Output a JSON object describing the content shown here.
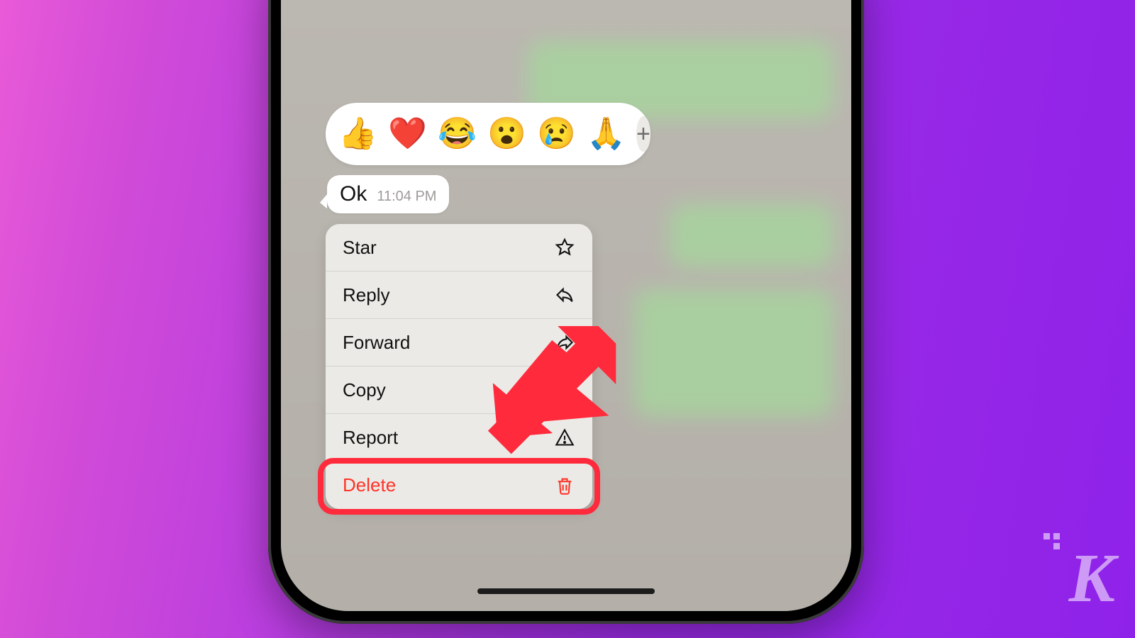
{
  "reactions": {
    "items": [
      "👍",
      "❤️",
      "😂",
      "😮",
      "😢",
      "🙏"
    ],
    "add_label": "+"
  },
  "message": {
    "text": "Ok",
    "time": "11:04 PM"
  },
  "menu": {
    "items": [
      {
        "label": "Star",
        "icon": "star-icon"
      },
      {
        "label": "Reply",
        "icon": "reply-icon"
      },
      {
        "label": "Forward",
        "icon": "forward-icon"
      },
      {
        "label": "Copy",
        "icon": "copy-icon"
      },
      {
        "label": "Report",
        "icon": "report-icon"
      },
      {
        "label": "Delete",
        "icon": "trash-icon",
        "destructive": true
      }
    ]
  },
  "annotation": {
    "highlight_color": "#ff2a3c",
    "arrow_color": "#ff2a3c"
  },
  "watermark": {
    "letter": "K"
  }
}
